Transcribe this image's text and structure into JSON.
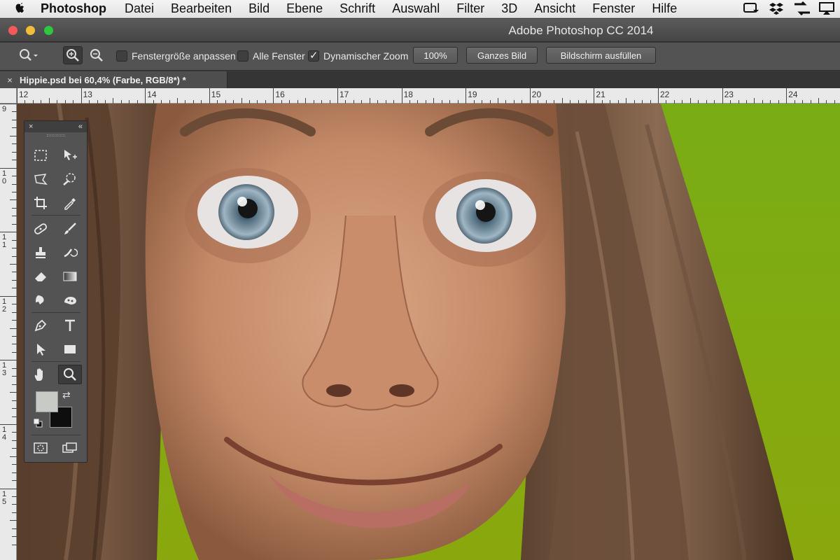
{
  "menubar": {
    "apple": "",
    "app": "Photoshop",
    "items": [
      "Datei",
      "Bearbeiten",
      "Bild",
      "Ebene",
      "Schrift",
      "Auswahl",
      "Filter",
      "3D",
      "Ansicht",
      "Fenster",
      "Hilfe"
    ]
  },
  "window": {
    "title": "Adobe Photoshop CC 2014"
  },
  "options": {
    "fit_window": {
      "label": "Fenstergröße anpassen",
      "checked": false
    },
    "all_windows": {
      "label": "Alle Fenster",
      "checked": false
    },
    "scrubby_zoom": {
      "label": "Dynamischer Zoom",
      "checked": true
    },
    "btn_100": "100%",
    "btn_fit": "Ganzes Bild",
    "btn_fill": "Bildschirm ausfüllen"
  },
  "document": {
    "tab_label": "Hippie.psd bei 60,4% (Farbe, RGB/8*) *"
  },
  "rulers": {
    "top": [
      "12",
      "13",
      "14",
      "15",
      "16",
      "17",
      "18",
      "19",
      "20",
      "21",
      "22",
      "23",
      "24"
    ],
    "left": [
      "9",
      "10",
      "11",
      "12",
      "13",
      "14",
      "15"
    ]
  },
  "colors": {
    "foreground": "#c8cac6",
    "background": "#0e0e0e"
  }
}
